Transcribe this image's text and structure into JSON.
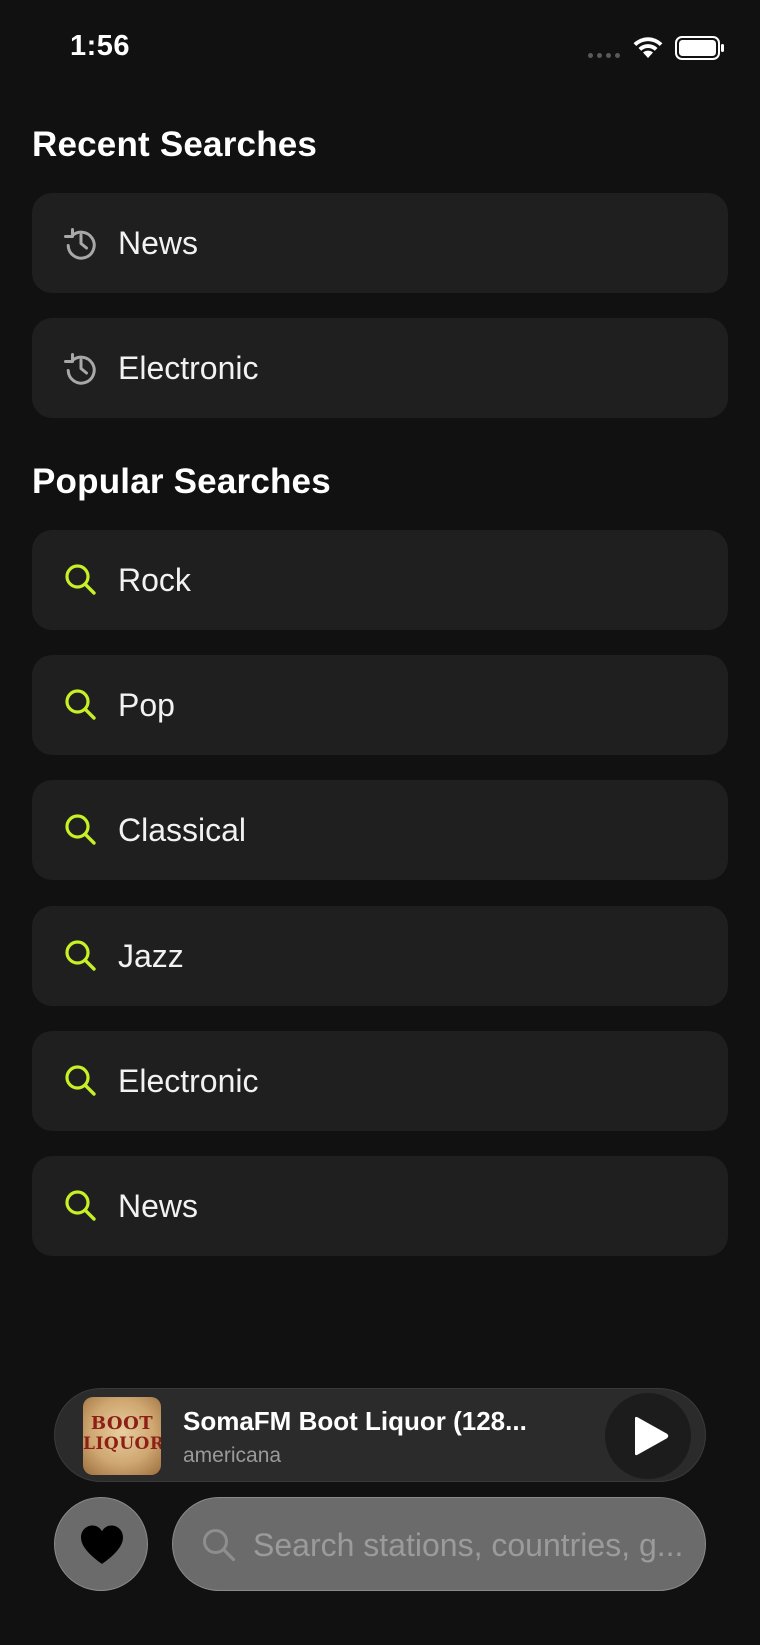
{
  "status_bar": {
    "time": "1:56"
  },
  "recent": {
    "title": "Recent Searches",
    "items": [
      {
        "label": "News",
        "icon": "history-icon"
      },
      {
        "label": "Electronic",
        "icon": "history-icon"
      }
    ]
  },
  "popular": {
    "title": "Popular Searches",
    "items": [
      {
        "label": "Rock",
        "icon": "search-icon"
      },
      {
        "label": "Pop",
        "icon": "search-icon"
      },
      {
        "label": "Classical",
        "icon": "search-icon"
      },
      {
        "label": "Jazz",
        "icon": "search-icon"
      },
      {
        "label": "Electronic",
        "icon": "search-icon"
      },
      {
        "label": "News",
        "icon": "search-icon"
      }
    ]
  },
  "player": {
    "title": "SomaFM Boot Liquor (128...",
    "subtitle": "americana",
    "artwork_text_line1": "BOOT",
    "artwork_text_line2": "LIQUOR"
  },
  "search": {
    "placeholder": "Search stations, countries, g..."
  },
  "colors": {
    "background": "#111111",
    "row": "#1f1f1f",
    "accent": "#c8f026",
    "history_icon": "#a8a8a8"
  }
}
